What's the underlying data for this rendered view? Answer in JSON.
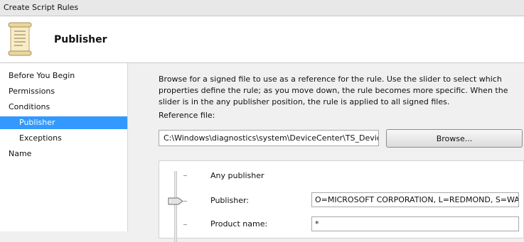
{
  "window": {
    "title": "Create Script Rules"
  },
  "header": {
    "title": "Publisher",
    "icon": "scroll-icon"
  },
  "sidebar": {
    "items": [
      {
        "label": "Before You Begin",
        "selected": false,
        "indent": false
      },
      {
        "label": "Permissions",
        "selected": false,
        "indent": false
      },
      {
        "label": "Conditions",
        "selected": false,
        "indent": false
      },
      {
        "label": "Publisher",
        "selected": true,
        "indent": true
      },
      {
        "label": "Exceptions",
        "selected": false,
        "indent": true
      },
      {
        "label": "Name",
        "selected": false,
        "indent": false
      }
    ]
  },
  "main": {
    "description": "Browse for a signed file to use as a reference for the rule. Use the slider to select which properties define the rule; as you move down, the rule becomes more specific. When the slider is in the any publisher position, the rule is applied to all signed files.",
    "reference_label": "Reference file:",
    "reference_value": "C:\\Windows\\diagnostics\\system\\DeviceCenter\\TS_DeviceCenter",
    "browse_label": "Browse...",
    "levels": [
      {
        "label": "Any publisher",
        "value": null
      },
      {
        "label": "Publisher:",
        "value": "O=MICROSOFT CORPORATION, L=REDMOND, S=WASHINGTON, C=US"
      },
      {
        "label": "Product name:",
        "value": "*"
      }
    ],
    "slider_selected_index": 1
  },
  "colors": {
    "selection": "#3399ff"
  }
}
